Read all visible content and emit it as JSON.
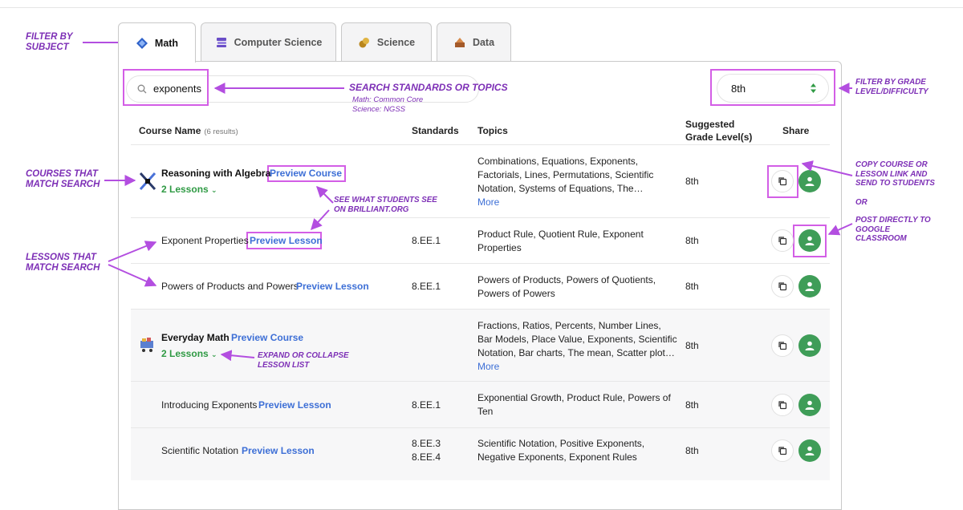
{
  "tabs": [
    {
      "label": "Math",
      "icon": "math-icon",
      "active": true
    },
    {
      "label": "Computer Science",
      "icon": "computer-science-icon",
      "active": false
    },
    {
      "label": "Science",
      "icon": "science-icon",
      "active": false
    },
    {
      "label": "Data",
      "icon": "data-icon",
      "active": false
    }
  ],
  "search": {
    "value": "exponents",
    "icon": "search-icon"
  },
  "grade_select": {
    "value": "8th",
    "icon": "sort-arrows-icon"
  },
  "table": {
    "headers": {
      "course_name": "Course Name",
      "results": "(6 results)",
      "standards": "Standards",
      "topics": "Topics",
      "grade_line1": "Suggested",
      "grade_line2": "Grade Level(s)",
      "share": "Share"
    },
    "rows": [
      {
        "kind": "course",
        "name": "Reasoning with Algebra",
        "preview": "Preview Course",
        "lessons": "2 Lessons",
        "standards": [],
        "topics": [
          "Combinations, Equations, Exponents,",
          "Factorials, Lines, Permutations, Scientific",
          "Notation, Systems of Equations, The…"
        ],
        "more": "More",
        "grade": "8th"
      },
      {
        "kind": "lesson",
        "name": "Exponent Properties",
        "preview": "Preview Lesson",
        "standards": [
          "8.EE.1"
        ],
        "topics": [
          "Product Rule, Quotient Rule, Exponent",
          "Properties"
        ],
        "grade": "8th"
      },
      {
        "kind": "lesson",
        "name": "Powers of Products and Powers",
        "preview": "Preview Lesson",
        "standards": [
          "8.EE.1"
        ],
        "topics": [
          "Powers of Products, Powers of Quotients,",
          "Powers of Powers"
        ],
        "grade": "8th"
      },
      {
        "kind": "course",
        "name": "Everyday Math",
        "preview": "Preview Course",
        "lessons": "2 Lessons",
        "standards": [],
        "topics": [
          "Fractions, Ratios, Percents, Number Lines,",
          "Bar Models, Place Value, Exponents, Scientific",
          "Notation, Bar charts, The mean, Scatter plot…"
        ],
        "more": "More",
        "grade": "8th"
      },
      {
        "kind": "lesson",
        "name": "Introducing Exponents",
        "preview": "Preview Lesson",
        "standards": [
          "8.EE.1"
        ],
        "topics": [
          "Exponential Growth, Product Rule, Powers of",
          "Ten"
        ],
        "grade": "8th"
      },
      {
        "kind": "lesson",
        "name": "Scientific Notation",
        "preview": "Preview Lesson",
        "standards": [
          "8.EE.3",
          "8.EE.4"
        ],
        "topics": [
          "Scientific Notation, Positive Exponents,",
          "Negative Exponents, Exponent Rules"
        ],
        "grade": "8th"
      }
    ]
  },
  "annotations": {
    "filter_subject": [
      "FILTER BY",
      "SUBJECT"
    ],
    "search": "SEARCH STANDARDS OR TOPICS",
    "search_note": [
      "Math: Common Core",
      "Science: NGSS"
    ],
    "filter_grade": [
      "FILTER BY GRADE",
      "LEVEL/DIFFICULTY"
    ],
    "courses": [
      "COURSES THAT",
      "MATCH SEARCH"
    ],
    "lessons": [
      "LESSONS THAT",
      "MATCH SEARCH"
    ],
    "see_students": [
      "SEE WHAT STUDENTS SEE",
      "ON BRILLIANT.ORG"
    ],
    "expand": [
      "EXPAND OR COLLAPSE",
      "LESSON LIST"
    ],
    "copy": [
      "COPY COURSE OR",
      "LESSON LINK AND",
      "SEND TO STUDENTS"
    ],
    "or": "OR",
    "post": [
      "POST DIRECTLY TO",
      "GOOGLE",
      "CLASSROOM"
    ]
  },
  "colors": {
    "annotation": "#7d2fb6",
    "highlight": "#d35ee6",
    "link": "#3d6fd6",
    "green": "#2f9a44",
    "classroom": "#3f9d58"
  }
}
